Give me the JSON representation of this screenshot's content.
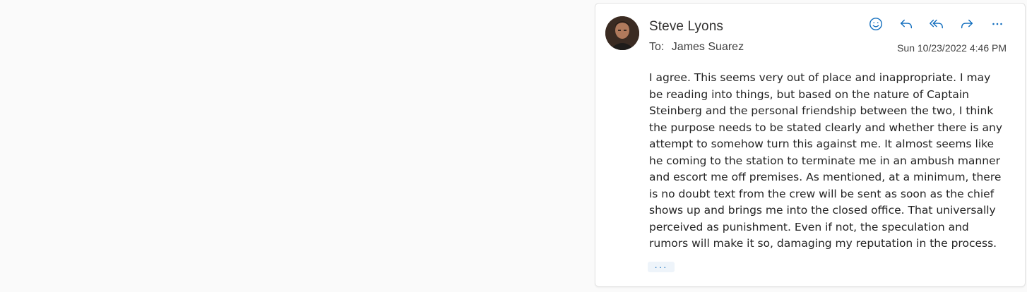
{
  "message": {
    "sender_name": "Steve Lyons",
    "to_label": "To:",
    "recipient": "James Suarez",
    "timestamp": "Sun 10/23/2022 4:46 PM",
    "body": "I agree. This seems very out of place and inappropriate. I may\nbe reading into things, but based on the nature of Captain\nSteinberg and the personal friendship between the two, I think\nthe purpose needs to be stated clearly and whether there is any\nattempt to somehow turn this against me. It almost seems like\nhe coming to the station to terminate me in an ambush manner\nand escort me off premises. As mentioned, at a minimum, there\nis no doubt text from the crew will be sent as soon as the chief\nshows up and brings me into the closed office. That universally\nperceived as punishment. Even if not, the speculation and\nrumors will make it so, damaging my reputation in the process.",
    "show_more_label": "···"
  },
  "actions": [
    {
      "name": "emoji-react",
      "icon": "smiley-icon"
    },
    {
      "name": "reply",
      "icon": "reply-icon"
    },
    {
      "name": "reply-all",
      "icon": "reply-all-icon"
    },
    {
      "name": "forward",
      "icon": "forward-icon"
    },
    {
      "name": "more-actions",
      "icon": "more-icon"
    }
  ],
  "colors": {
    "accent": "#0f6cbd",
    "background": "#fafafa",
    "card": "#ffffff"
  }
}
